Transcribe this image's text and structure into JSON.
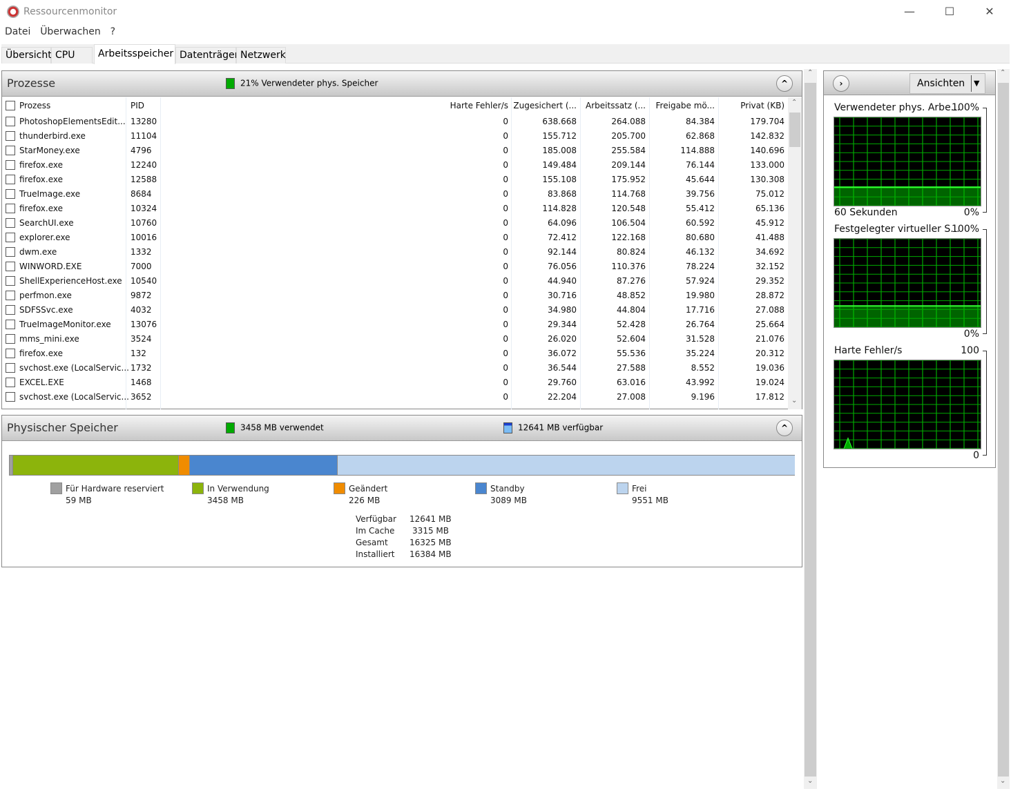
{
  "window": {
    "title": "Ressourcenmonitor",
    "minimize": "—",
    "maximize": "☐",
    "close": "✕"
  },
  "menu": [
    "Datei",
    "Überwachen",
    "?"
  ],
  "tabs": [
    "Übersicht",
    "CPU",
    "Arbeitsspeicher",
    "Datenträger",
    "Netzwerk"
  ],
  "active_tab": "Arbeitsspeicher",
  "processes": {
    "title": "Prozesse",
    "status": "21% Verwendeter phys. Speicher",
    "columns": [
      "Prozess",
      "PID",
      "Harte Fehler/s",
      "Zugesichert (...",
      "Arbeitssatz (...",
      "Freigabe mö...",
      "Privat (KB)"
    ],
    "rows": [
      [
        "PhotoshopElementsEdit...",
        "13280",
        "0",
        "638.668",
        "264.088",
        "84.384",
        "179.704"
      ],
      [
        "thunderbird.exe",
        "11104",
        "0",
        "155.712",
        "205.700",
        "62.868",
        "142.832"
      ],
      [
        "StarMoney.exe",
        "4796",
        "0",
        "185.008",
        "255.584",
        "114.888",
        "140.696"
      ],
      [
        "firefox.exe",
        "12240",
        "0",
        "149.484",
        "209.144",
        "76.144",
        "133.000"
      ],
      [
        "firefox.exe",
        "12588",
        "0",
        "155.108",
        "175.952",
        "45.644",
        "130.308"
      ],
      [
        "TrueImage.exe",
        "8684",
        "0",
        "83.868",
        "114.768",
        "39.756",
        "75.012"
      ],
      [
        "firefox.exe",
        "10324",
        "0",
        "114.828",
        "120.548",
        "55.412",
        "65.136"
      ],
      [
        "SearchUI.exe",
        "10760",
        "0",
        "64.096",
        "106.504",
        "60.592",
        "45.912"
      ],
      [
        "explorer.exe",
        "10016",
        "0",
        "72.412",
        "122.168",
        "80.680",
        "41.488"
      ],
      [
        "dwm.exe",
        "1332",
        "0",
        "92.144",
        "80.824",
        "46.132",
        "34.692"
      ],
      [
        "WINWORD.EXE",
        "7000",
        "0",
        "76.056",
        "110.376",
        "78.224",
        "32.152"
      ],
      [
        "ShellExperienceHost.exe",
        "10540",
        "0",
        "44.940",
        "87.276",
        "57.924",
        "29.352"
      ],
      [
        "perfmon.exe",
        "9872",
        "0",
        "30.716",
        "48.852",
        "19.980",
        "28.872"
      ],
      [
        "SDFSSvc.exe",
        "4032",
        "0",
        "34.980",
        "44.804",
        "17.716",
        "27.088"
      ],
      [
        "TrueImageMonitor.exe",
        "13076",
        "0",
        "29.344",
        "52.428",
        "26.764",
        "25.664"
      ],
      [
        "mms_mini.exe",
        "3524",
        "0",
        "26.020",
        "52.604",
        "31.528",
        "21.076"
      ],
      [
        "firefox.exe",
        "132",
        "0",
        "36.072",
        "55.536",
        "35.224",
        "20.312"
      ],
      [
        "svchost.exe (LocalServic...",
        "1732",
        "0",
        "36.544",
        "27.588",
        "8.552",
        "19.036"
      ],
      [
        "EXCEL.EXE",
        "1468",
        "0",
        "29.760",
        "63.016",
        "43.992",
        "19.024"
      ],
      [
        "svchost.exe (LocalServic...",
        "3652",
        "0",
        "22.204",
        "27.008",
        "9.196",
        "17.812"
      ]
    ]
  },
  "physical": {
    "title": "Physischer Speicher",
    "used_label": "3458 MB verwendet",
    "available_label": "12641 MB verfügbar",
    "segments": [
      {
        "label": "Für Hardware reserviert",
        "value": "59 MB",
        "mb": 59,
        "color": "#a0a0a0"
      },
      {
        "label": "In Verwendung",
        "value": "3458 MB",
        "mb": 3458,
        "color": "#8cb40c"
      },
      {
        "label": "Geändert",
        "value": "226 MB",
        "mb": 226,
        "color": "#f08c00"
      },
      {
        "label": "Standby",
        "value": "3089 MB",
        "mb": 3089,
        "color": "#4a86cf"
      },
      {
        "label": "Frei",
        "value": "9551 MB",
        "mb": 9551,
        "color": "#bcd4ee"
      }
    ],
    "summary": [
      [
        "Verfügbar",
        "12641 MB"
      ],
      [
        "Im Cache",
        "3315 MB"
      ],
      [
        "Gesamt",
        "16325 MB"
      ],
      [
        "Installiert",
        "16384 MB"
      ]
    ]
  },
  "side": {
    "views_button": "Ansichten",
    "graphs": [
      {
        "title": "Verwendeter phys. Arbe...",
        "max": "100%",
        "min": "0%",
        "time": "60 Sekunden",
        "level_percent": 21
      },
      {
        "title": "Festgelegter virtueller S...",
        "max": "100%",
        "min": "0%",
        "level_percent": 24
      },
      {
        "title": "Harte Fehler/s",
        "max": "100",
        "min": "0",
        "spike_value": 12
      }
    ]
  }
}
